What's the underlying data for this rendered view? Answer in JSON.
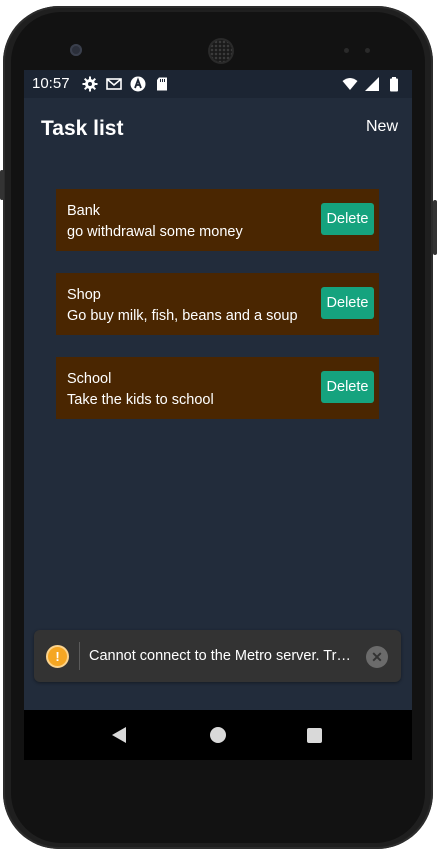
{
  "status_bar": {
    "time": "10:57",
    "left_icons": [
      "gear-icon",
      "gmail-icon",
      "react-native-icon",
      "sd-card-icon"
    ],
    "right_icons": [
      "wifi-icon",
      "signal-icon",
      "battery-icon"
    ]
  },
  "app_bar": {
    "title": "Task list",
    "new_label": "New"
  },
  "tasks": [
    {
      "title": "Bank",
      "description": "go withdrawal some money",
      "delete_label": "Delete"
    },
    {
      "title": "Shop",
      "description": "Go buy milk, fish, beans and a soup",
      "delete_label": "Delete"
    },
    {
      "title": "School",
      "description": "Take the kids to school",
      "delete_label": "Delete"
    }
  ],
  "toast": {
    "icon": "warning-icon",
    "icon_glyph": "!",
    "message": "Cannot connect to the Metro server.  Tr…",
    "close_icon": "close-icon"
  },
  "nav_bar": {
    "icons": [
      "back-icon",
      "home-icon",
      "recents-icon"
    ]
  },
  "colors": {
    "screen_background": "#222c3b",
    "card_background": "#4a2601",
    "delete_button": "#15a37e",
    "toast_background": "#333333",
    "warning": "#f5a623"
  }
}
